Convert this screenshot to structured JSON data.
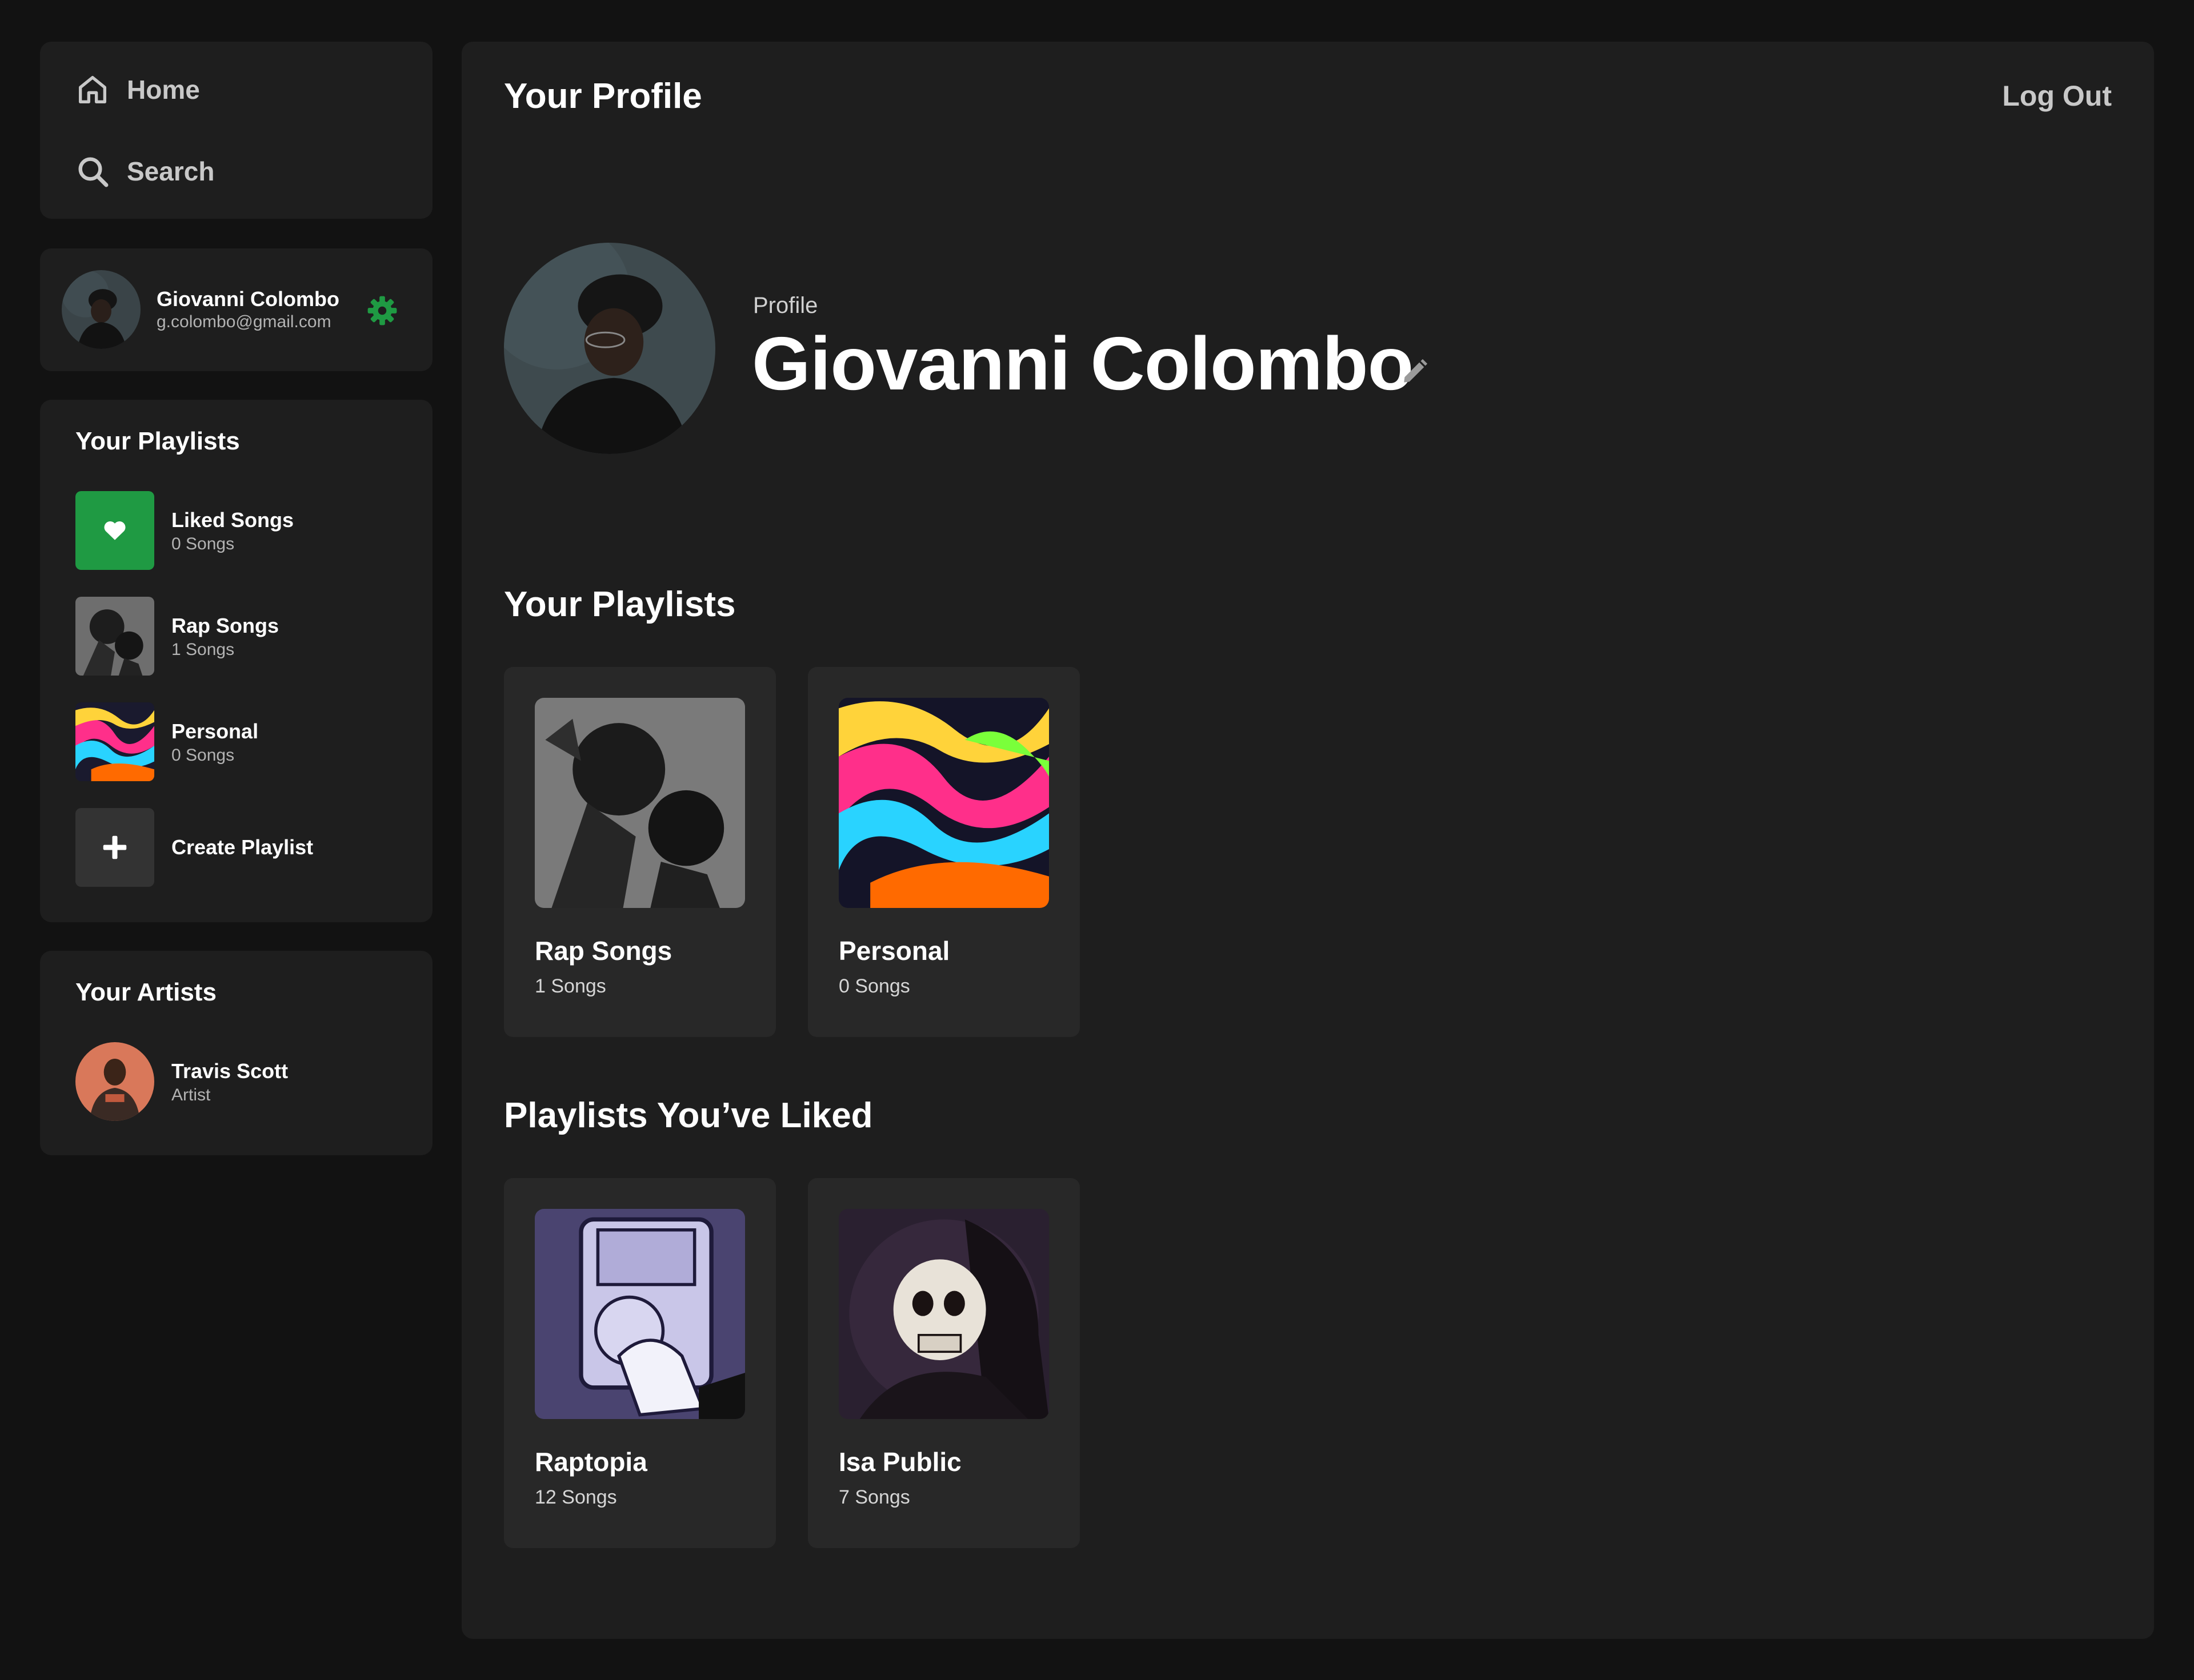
{
  "nav": {
    "home_label": "Home",
    "search_label": "Search"
  },
  "user": {
    "name": "Giovanni Colombo",
    "email": "g.colombo@gmail.com"
  },
  "sidebar_playlists": {
    "title": "Your Playlists",
    "items": [
      {
        "name": "Liked Songs",
        "sub": "0 Songs"
      },
      {
        "name": "Rap Songs",
        "sub": "1 Songs"
      },
      {
        "name": "Personal",
        "sub": "0 Songs"
      }
    ],
    "create_label": "Create Playlist"
  },
  "sidebar_artists": {
    "title": "Your Artists",
    "items": [
      {
        "name": "Travis Scott",
        "sub": "Artist"
      }
    ]
  },
  "main": {
    "title": "Your Profile",
    "logout_label": "Log Out",
    "profile_label": "Profile",
    "profile_name": "Giovanni Colombo",
    "your_playlists_title": "Your Playlists",
    "your_playlists": [
      {
        "name": "Rap Songs",
        "sub": "1 Songs"
      },
      {
        "name": "Personal",
        "sub": "0 Songs"
      }
    ],
    "liked_title": "Playlists You’ve Liked",
    "liked_playlists": [
      {
        "name": "Raptopia",
        "sub": "12 Songs"
      },
      {
        "name": "Isa Public",
        "sub": "7 Songs"
      }
    ]
  },
  "colors": {
    "accent_green": "#1f9a43",
    "background": "#121212",
    "panel": "#1e1e1e",
    "card": "#282828"
  },
  "icons": [
    "home-icon",
    "search-icon",
    "gear-icon",
    "heart-icon",
    "plus-icon",
    "edit-icon"
  ]
}
